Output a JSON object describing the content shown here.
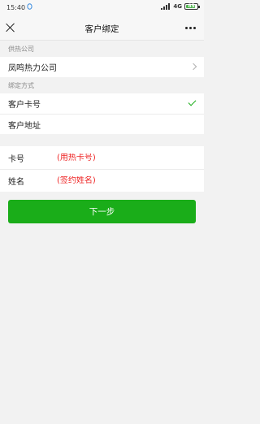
{
  "status_bar": {
    "time": "15:40",
    "network": "4G",
    "battery": "85"
  },
  "nav": {
    "title": "客户绑定"
  },
  "supplier_section": {
    "label": "供热公司",
    "company": "凤鸣热力公司"
  },
  "bind_section": {
    "label": "绑定方式",
    "options": [
      {
        "label": "客户卡号",
        "selected": true
      },
      {
        "label": "客户地址",
        "selected": false
      }
    ]
  },
  "form": {
    "card_label": "卡号",
    "card_placeholder": "(用热卡号)",
    "name_label": "姓名",
    "name_placeholder": "(签约姓名)"
  },
  "next_button": "下一步",
  "colors": {
    "accent": "#1aad19",
    "placeholder": "#e22222"
  }
}
